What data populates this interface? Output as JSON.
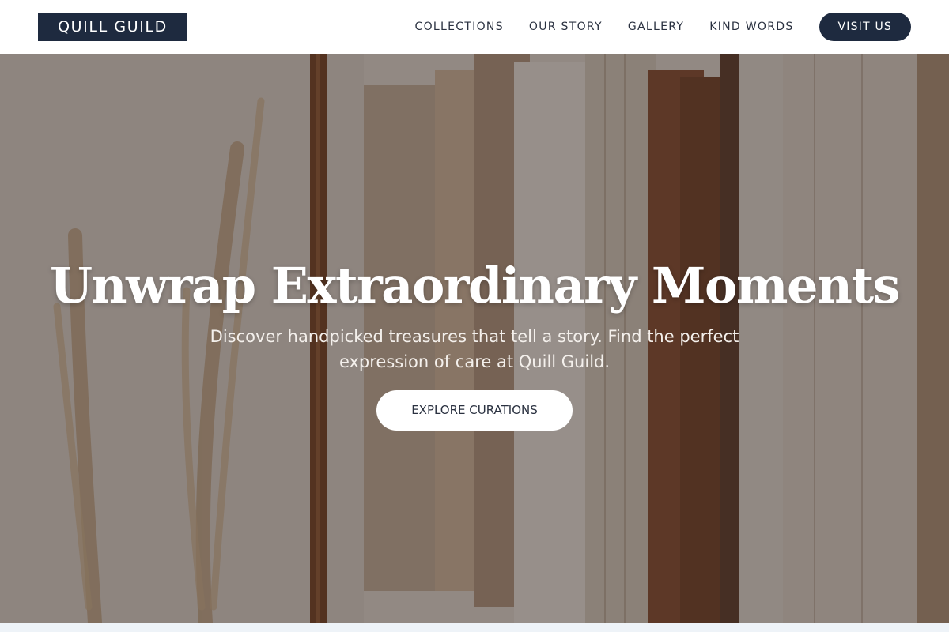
{
  "header": {
    "logo_text": "QUILL GUILD",
    "nav_items": [
      "COLLECTIONS",
      "OUR STORY",
      "GALLERY",
      "KIND WORDS"
    ],
    "visit_button": "VISIT US"
  },
  "hero": {
    "title": "Unwrap Extraordinary Moments",
    "subtitle": "Discover handpicked treasures that tell a story. Find the perfect expression of care at Quill Guild.",
    "cta_label": "EXPLORE CURATIONS"
  },
  "colors": {
    "brand_navy": "#1e2a3f",
    "nav_text": "#2a3140",
    "hero_text": "#ffffff",
    "bottom_strip": "#eef3f8"
  }
}
